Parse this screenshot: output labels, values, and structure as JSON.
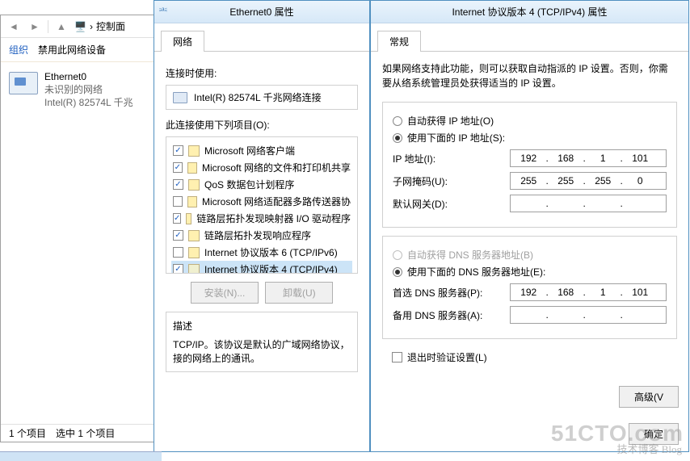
{
  "bgwin": {
    "path_label": "控制面",
    "organize": "组织",
    "disable": "禁用此网络设备",
    "adapter_name": "Ethernet0",
    "adapter_sub1": "未识别的网络",
    "adapter_sub2": "Intel(R) 82574L 千兆",
    "footer_count": "1 个项目",
    "footer_sel": "选中 1 个项目"
  },
  "dlg1": {
    "title": "Ethernet0 属性",
    "tab": "网络",
    "connect_using": "连接时使用:",
    "adapter": "Intel(R) 82574L 千兆网络连接",
    "uses_items": "此连接使用下列项目(O):",
    "items": [
      {
        "c": true,
        "t": "Microsoft 网络客户端"
      },
      {
        "c": true,
        "t": "Microsoft 网络的文件和打印机共享"
      },
      {
        "c": true,
        "t": "QoS 数据包计划程序"
      },
      {
        "c": false,
        "t": "Microsoft 网络适配器多路传送器协"
      },
      {
        "c": true,
        "t": "链路层拓扑发现映射器 I/O 驱动程序"
      },
      {
        "c": true,
        "t": "链路层拓扑发现响应程序"
      },
      {
        "c": false,
        "t": "Internet 协议版本 6 (TCP/IPv6)"
      },
      {
        "c": true,
        "t": "Internet 协议版本 4 (TCP/IPv4)",
        "sel": true
      }
    ],
    "install": "安装(N)...",
    "uninstall": "卸载(U)",
    "desc_t": "描述",
    "desc_b": "TCP/IP。该协议是默认的广域网络协议，接的网络上的通讯。"
  },
  "dlg2": {
    "title": "Internet 协议版本 4 (TCP/IPv4) 属性",
    "tab": "常规",
    "help": "如果网络支持此功能，则可以获取自动指派的 IP 设置。否则，你需要从络系统管理员处获得适当的 IP 设置。",
    "auto_ip": "自动获得 IP 地址(O)",
    "use_ip": "使用下面的 IP 地址(S):",
    "ip_l": "IP 地址(I):",
    "mask_l": "子网掩码(U):",
    "gw_l": "默认网关(D):",
    "ip": [
      "192",
      "168",
      "1",
      "101"
    ],
    "mask": [
      "255",
      "255",
      "255",
      "0"
    ],
    "gw": [
      "",
      "",
      "",
      ""
    ],
    "auto_dns": "自动获得 DNS 服务器地址(B)",
    "use_dns": "使用下面的 DNS 服务器地址(E):",
    "dns1_l": "首选 DNS 服务器(P):",
    "dns2_l": "备用 DNS 服务器(A):",
    "dns1": [
      "192",
      "168",
      "1",
      "101"
    ],
    "dns2": [
      "",
      "",
      "",
      ""
    ],
    "validate": "退出时验证设置(L)",
    "adv": "高级(V",
    "ok": "确定"
  },
  "wm": {
    "main": "51CTO.com",
    "sub": "技术博客   Blog"
  }
}
